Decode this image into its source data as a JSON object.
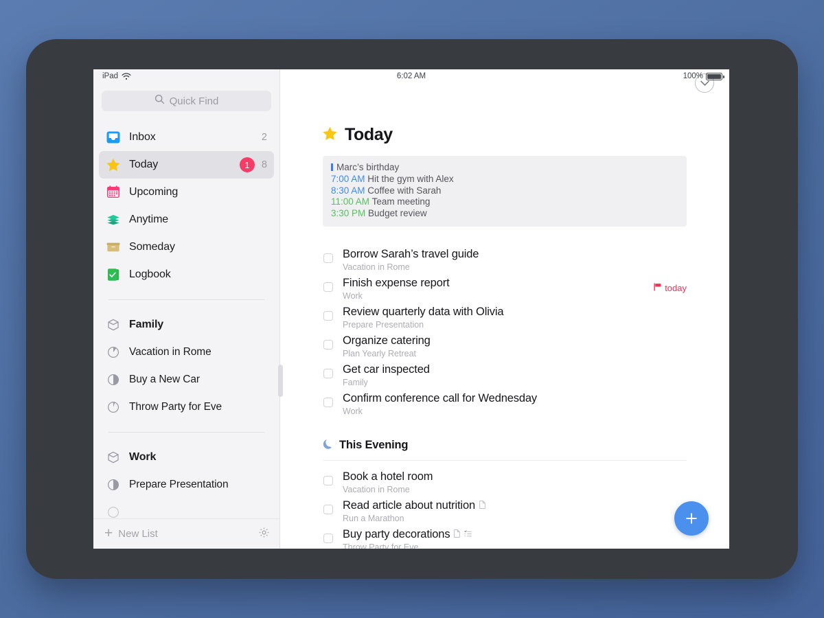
{
  "statusbar": {
    "device_label": "iPad",
    "wifi_icon": "wifi-icon",
    "time": "6:02 AM",
    "battery_percent": "100%",
    "battery_icon": "battery-full-icon"
  },
  "sidebar": {
    "search": {
      "icon": "search-icon",
      "placeholder": "Quick Find"
    },
    "items": [
      {
        "icon": "inbox-tray-icon",
        "label": "Inbox",
        "count": "2",
        "badge": "",
        "selected": false,
        "kind": "smart"
      },
      {
        "icon": "star-icon",
        "label": "Today",
        "count": "8",
        "badge": "1",
        "selected": true,
        "kind": "smart"
      },
      {
        "icon": "calendar-icon",
        "label": "Upcoming",
        "count": "",
        "badge": "",
        "selected": false,
        "kind": "smart"
      },
      {
        "icon": "stack-icon",
        "label": "Anytime",
        "count": "",
        "badge": "",
        "selected": false,
        "kind": "smart"
      },
      {
        "icon": "box-icon",
        "label": "Someday",
        "count": "",
        "badge": "",
        "selected": false,
        "kind": "smart"
      },
      {
        "icon": "logbook-icon",
        "label": "Logbook",
        "count": "",
        "badge": "",
        "selected": false,
        "kind": "smart"
      }
    ],
    "groups": [
      {
        "icon": "area-icon",
        "label": "Family",
        "projects": [
          {
            "icon": "progress-pie-icon",
            "label": "Vacation in Rome",
            "progress": 22
          },
          {
            "icon": "progress-pie-icon",
            "label": "Buy a New Car",
            "progress": 50
          },
          {
            "icon": "progress-pie-icon",
            "label": "Throw Party for Eve",
            "progress": 12
          }
        ]
      },
      {
        "icon": "area-icon",
        "label": "Work",
        "projects": [
          {
            "icon": "progress-pie-icon",
            "label": "Prepare Presentation",
            "progress": 50
          }
        ]
      }
    ],
    "footer": {
      "add_icon": "plus-icon",
      "new_list_label": "New List",
      "settings_icon": "gear-icon"
    },
    "drag_handle": "pane-drag-handle"
  },
  "main": {
    "collapse_icon": "chevron-down-circle-icon",
    "title": {
      "icon": "star-icon",
      "text": "Today"
    },
    "calendar": [
      {
        "marker": "all-day-bar",
        "time": "",
        "time_color": "",
        "text": "Marc’s birthday"
      },
      {
        "marker": "",
        "time": "7:00 AM",
        "time_color": "blue",
        "text": "Hit the gym with Alex"
      },
      {
        "marker": "",
        "time": "8:30 AM",
        "time_color": "blue",
        "text": "Coffee with Sarah"
      },
      {
        "marker": "",
        "time": "11:00 AM",
        "time_color": "green",
        "text": "Team meeting"
      },
      {
        "marker": "",
        "time": "3:30 PM",
        "time_color": "green",
        "text": "Budget review"
      }
    ],
    "today_tasks": [
      {
        "title": "Borrow Sarah’s travel guide",
        "project": "Vacation in Rome",
        "tag": "",
        "tag_icon": "",
        "indicators": []
      },
      {
        "title": "Finish expense report",
        "project": "Work",
        "tag": "today",
        "tag_icon": "flag-icon",
        "indicators": []
      },
      {
        "title": "Review quarterly data with Olivia",
        "project": "Prepare Presentation",
        "tag": "",
        "tag_icon": "",
        "indicators": []
      },
      {
        "title": "Organize catering",
        "project": "Plan Yearly Retreat",
        "tag": "",
        "tag_icon": "",
        "indicators": []
      },
      {
        "title": "Get car inspected",
        "project": "Family",
        "tag": "",
        "tag_icon": "",
        "indicators": []
      },
      {
        "title": "Confirm conference call for Wednesday",
        "project": "Work",
        "tag": "",
        "tag_icon": "",
        "indicators": []
      }
    ],
    "evening": {
      "icon": "moon-icon",
      "label": "This Evening",
      "tasks": [
        {
          "title": "Book a hotel room",
          "project": "Vacation in Rome",
          "indicators": []
        },
        {
          "title": "Read article about nutrition",
          "project": "Run a Marathon",
          "indicators": [
            "note-icon"
          ]
        },
        {
          "title": "Buy party decorations",
          "project": "Throw Party for Eve",
          "indicators": [
            "note-icon",
            "checklist-icon"
          ]
        }
      ]
    },
    "add_button": {
      "icon": "plus-icon",
      "label": "New To-Do"
    }
  },
  "colors": {
    "accent_blue": "#4a90ec",
    "badge_pink": "#f73d67",
    "tag_red": "#fb2f55",
    "star_yellow": "#f9c613",
    "event_blue": "#3d8bf2",
    "event_green": "#56c15c",
    "sidebar_bg": "#f4f4f6",
    "bezel": "#383c40",
    "backdrop": "#4f6fa5"
  }
}
